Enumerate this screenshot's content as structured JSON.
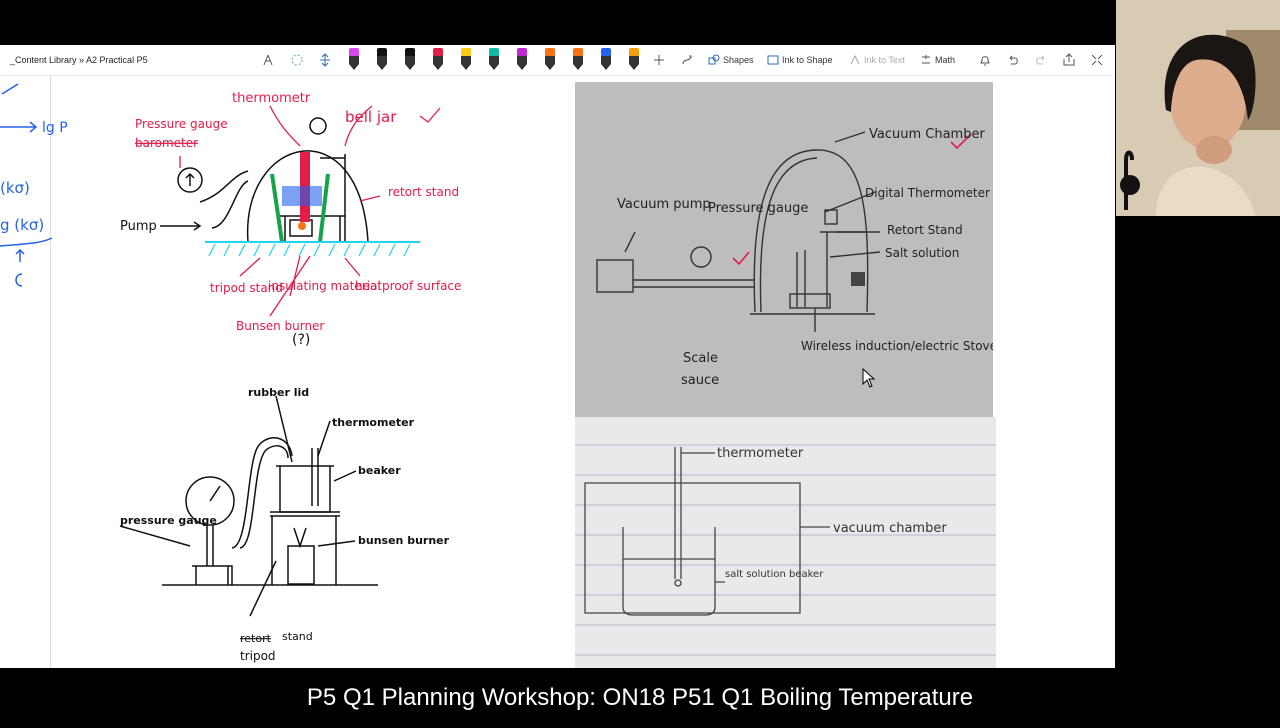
{
  "toolbar": {
    "breadcrumb": "_Content Library » A2 Practical P5",
    "shapes_label": "Shapes",
    "ink_to_shape_label": "Ink to Shape",
    "ink_to_text_label": "Ink to Text",
    "math_label": "Math",
    "pens": [
      {
        "color": "#d946ef"
      },
      {
        "color": "#111111"
      },
      {
        "color": "#111111"
      },
      {
        "color": "#e11d48"
      },
      {
        "color": "#facc15"
      },
      {
        "color": "#14b8a6"
      },
      {
        "color": "#c026d3"
      },
      {
        "color": "#f97316"
      },
      {
        "color": "#f97316"
      },
      {
        "color": "#2563eb"
      },
      {
        "color": "#f59e0b"
      }
    ]
  },
  "margin_notes": {
    "lg_p": "lg P",
    "k_sigma_1": "(kσ)",
    "k_sigma_2": "g (kσ)",
    "c_note": "C"
  },
  "sketch1": {
    "thermometer": "thermometr",
    "pressure_gauge": "Pressure gauge",
    "barometer": "barometer",
    "bell_jar": "bell jar",
    "pump": "Pump",
    "retort_stand": "retort stand",
    "tripod_stand": "tripod stand",
    "insulating_material": "insulating material",
    "heatproof_surface": "heatproof surface",
    "bunsen_burner": "Bunsen burner",
    "question": "(?)"
  },
  "sketch2": {
    "rubber_lid": "rubber lid",
    "thermometer": "thermometer",
    "beaker": "beaker",
    "pressure_gauge": "pressure gauge",
    "bunsen_burner": "bunsen burner",
    "retort_stand_struck": "retort",
    "stand": "stand",
    "tripod": "tripod"
  },
  "photo1": {
    "vacuum_chamber": "Vacuum Chamber",
    "digital_thermometer": "Digital Thermometer",
    "retort_stand": "Retort Stand",
    "salt_solution": "Salt solution",
    "vacuum_pump": "Vacuum pump",
    "pressure_gauge": "Pressure gauge",
    "scale_left": "Scale",
    "scale_left2": "sauce",
    "stove": "Wireless induction/electric Stove"
  },
  "photo2": {
    "thermometer": "thermometer",
    "vacuum_chamber": "vacuum chamber",
    "salt_solution": "salt solution beaker"
  },
  "caption": "P5 Q1 Planning Workshop: ON18 P51 Q1 Boiling Temperature"
}
